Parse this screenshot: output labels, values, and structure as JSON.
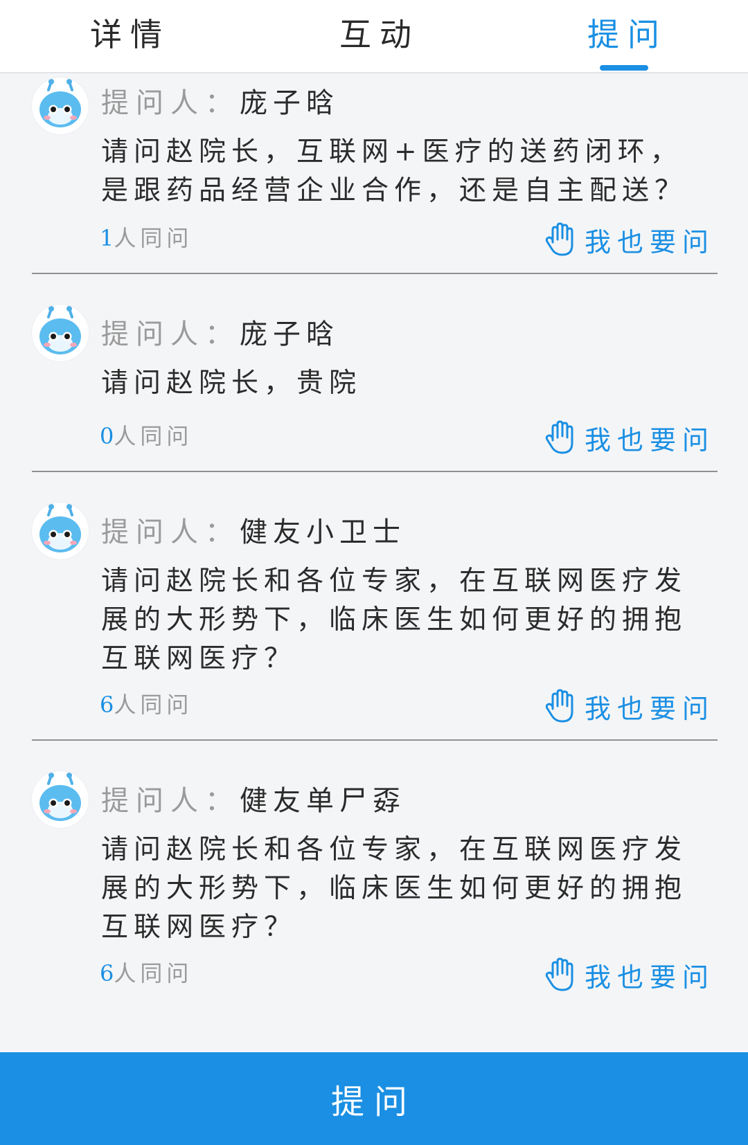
{
  "colors": {
    "accent": "#1a8fe3",
    "background": "#f4f5f7",
    "text_primary": "#2b2b2b",
    "text_secondary": "#9a9a9a"
  },
  "tabs": [
    {
      "label": "详情",
      "active": false
    },
    {
      "label": "互动",
      "active": false
    },
    {
      "label": "提问",
      "active": true
    }
  ],
  "questions": [
    {
      "asker_label": "提问人：",
      "asker_name": "庞子晗",
      "text": "请问赵院长，互联网+医疗的送药闭环，是跟药品经营企业合作，还是自主配送？",
      "same_count": "1",
      "same_suffix": "人同问",
      "ask_too": "我也要问",
      "avatar_icon": "cartoon-face-icon",
      "ask_icon": "raised-hand-icon"
    },
    {
      "asker_label": "提问人：",
      "asker_name": "庞子晗",
      "text": "请问赵院长，贵院",
      "same_count": "0",
      "same_suffix": "人同问",
      "ask_too": "我也要问",
      "avatar_icon": "cartoon-face-icon",
      "ask_icon": "raised-hand-icon"
    },
    {
      "asker_label": "提问人：",
      "asker_name": "健友小卫士",
      "text": "请问赵院长和各位专家，在互联网医疗发展的大形势下，临床医生如何更好的拥抱互联网医疗？",
      "same_count": "6",
      "same_suffix": "人同问",
      "ask_too": "我也要问",
      "avatar_icon": "cartoon-face-icon",
      "ask_icon": "raised-hand-icon"
    },
    {
      "asker_label": "提问人：",
      "asker_name": "健友单尸孬",
      "text": "请问赵院长和各位专家，在互联网医疗发展的大形势下，临床医生如何更好的拥抱互联网医疗？",
      "same_count": "6",
      "same_suffix": "人同问",
      "ask_too": "我也要问",
      "avatar_icon": "cartoon-face-icon",
      "ask_icon": "raised-hand-icon"
    }
  ],
  "bottom_button": {
    "label": "提问"
  }
}
